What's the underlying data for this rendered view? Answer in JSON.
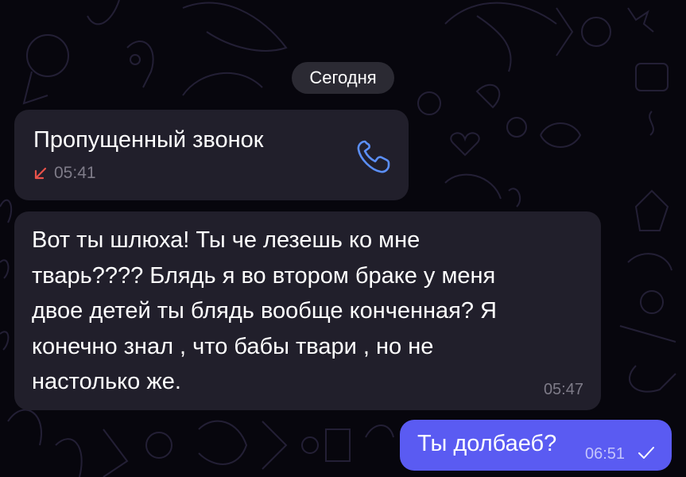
{
  "date_separator": "Сегодня",
  "messages": [
    {
      "kind": "missed-call",
      "title": "Пропущенный звонок",
      "time": "05:41",
      "icon": "phone-icon",
      "status_icon": "missed-call-arrow-icon"
    },
    {
      "kind": "incoming",
      "lines": [
        "Вот ты шлюха! Ты че лезешь ко мне",
        "тварь???? Блядь я  во втором браке у меня",
        "двое детей ты блядь вообще конченная? Я",
        "конечно знал , что бабы твари , но не",
        "настолько же."
      ],
      "time": "05:47"
    },
    {
      "kind": "outgoing",
      "text": "Ты долбаеб?",
      "time": "06:51",
      "status_icon": "check-icon"
    }
  ],
  "colors": {
    "background": "#07060d",
    "incoming_bubble": "#211f2b",
    "outgoing_bubble": "#5a5bf2",
    "date_chip": "#2b2a33",
    "missed_call": "#e8524a",
    "phone_icon": "#5b8ff9",
    "meta_text": "#7e7b88"
  }
}
